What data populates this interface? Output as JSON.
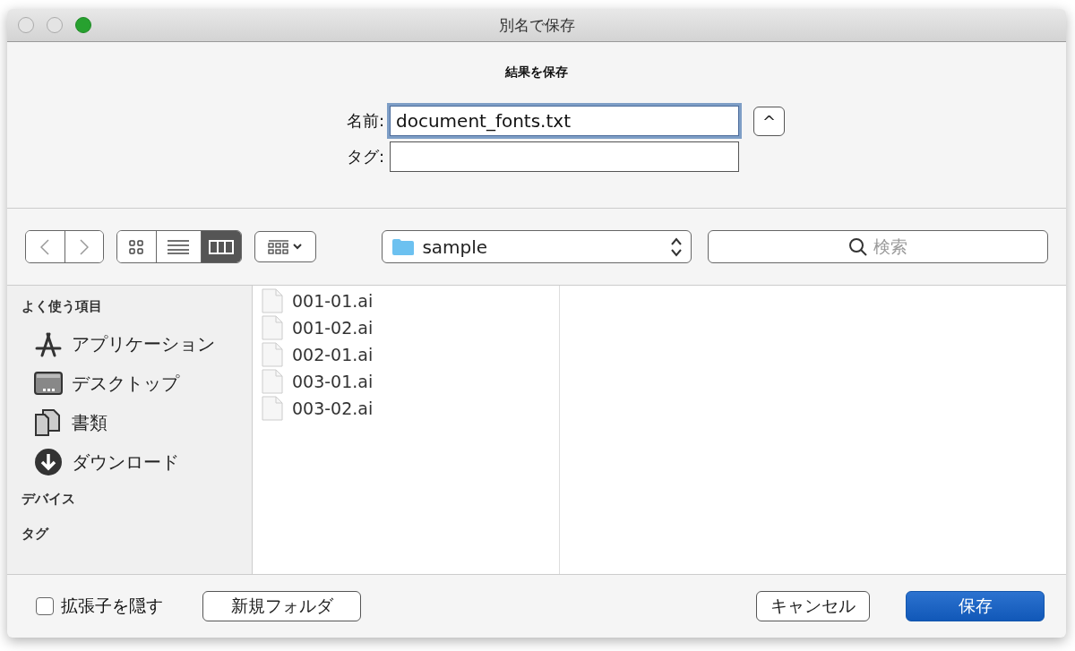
{
  "window": {
    "title": "別名で保存"
  },
  "header": {
    "message": "結果を保存",
    "name_label": "名前:",
    "name_value": "document_fonts.txt",
    "name_focused": true,
    "tag_label": "タグ:",
    "expand_button": "^"
  },
  "toolbar": {
    "view_modes": [
      {
        "kind": "icons",
        "selected": false
      },
      {
        "kind": "list",
        "selected": false
      },
      {
        "kind": "columns",
        "selected": true
      }
    ],
    "location": "sample",
    "search": {
      "placeholder": "検索"
    }
  },
  "sidebar": {
    "sections": [
      {
        "title": "よく使う項目",
        "items": [
          {
            "kind": "apps",
            "label": "アプリケーション"
          },
          {
            "kind": "desktop",
            "label": "デスクトップ"
          },
          {
            "kind": "documents",
            "label": "書類"
          },
          {
            "kind": "downloads",
            "label": "ダウンロード"
          }
        ]
      },
      {
        "title": "デバイス"
      },
      {
        "title": "タグ"
      }
    ]
  },
  "files": [
    {
      "name": "001-01.ai"
    },
    {
      "name": "001-02.ai"
    },
    {
      "name": "002-01.ai"
    },
    {
      "name": "003-01.ai"
    },
    {
      "name": "003-02.ai"
    }
  ],
  "footer": {
    "hide_extension": {
      "label": "拡張子を隠す",
      "checked": false
    },
    "new_folder": "新規フォルダ",
    "buttons": [
      {
        "kind": "secondary",
        "label": "キャンセル"
      },
      {
        "kind": "primary",
        "label": "保存"
      }
    ]
  }
}
